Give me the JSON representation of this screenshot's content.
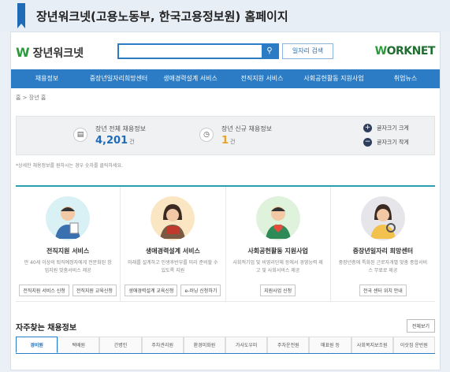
{
  "page_title": "장년워크넷(고용노동부, 한국고용정보원) 홈페이지",
  "logo": {
    "mark": "W",
    "name": "장년워크넷"
  },
  "search": {
    "placeholder": "",
    "button_icon": "search-icon",
    "jobs_button": "일자리 검색"
  },
  "brand": {
    "prefix": "W",
    "text": "ORKNET"
  },
  "nav": [
    "채용정보",
    "중장년일자리희망센터",
    "생애경력설계 서비스",
    "전직지원 서비스",
    "사회공헌활동 지원사업",
    "취업뉴스"
  ],
  "breadcrumb": "홈  >  장년 홈",
  "stats": {
    "total_label": "장년 전체 채용정보",
    "total_value": "4,201",
    "total_unit": "건",
    "new_label": "장년 신규 채용정보",
    "new_value": "1",
    "new_unit": "건"
  },
  "font_controls": {
    "increase": "글자크기 크게",
    "decrease": "글자크기 작게"
  },
  "note": "*상세한 채용정보를 원하시는 경우 숫자를 클릭하세요.",
  "cards": [
    {
      "title": "전직지원 서비스",
      "desc": "만 40세 이상의 퇴직예정자에게 전문화된 창업지원 맞춤서비스 제공",
      "buttons": [
        "전직지원 서비스 신청",
        "전직지원 교육신청"
      ]
    },
    {
      "title": "생애경력설계 서비스",
      "desc": "미래를 설계하고 인생후반부를 미리 준비할 수 있도록 지원",
      "buttons": [
        "생애경력설계 교육신청",
        "e-러닝 신청하기"
      ]
    },
    {
      "title": "사회공헌활동 지원사업",
      "desc": "사회적기업 및 비영리단체 등에서 경영능력 제고 및 사회서비스 제공",
      "buttons": [
        "지원사업 신청"
      ]
    },
    {
      "title": "중장년일자리 희망센터",
      "desc": "중장년층에 특화된 근로자개별 맞춤 종합서비스 무료로 제공",
      "buttons": [
        "전국 센터 위치 안내"
      ]
    }
  ],
  "frequent": {
    "title": "자주찾는 채용정보",
    "more": "전체보기",
    "tabs": [
      "경비원",
      "택배원",
      "간병인",
      "주차관리원",
      "환경미화원",
      "가사도우미",
      "주차운전원",
      "매표원 등",
      "사회복지보조원",
      "이삿짐 운반원"
    ]
  }
}
